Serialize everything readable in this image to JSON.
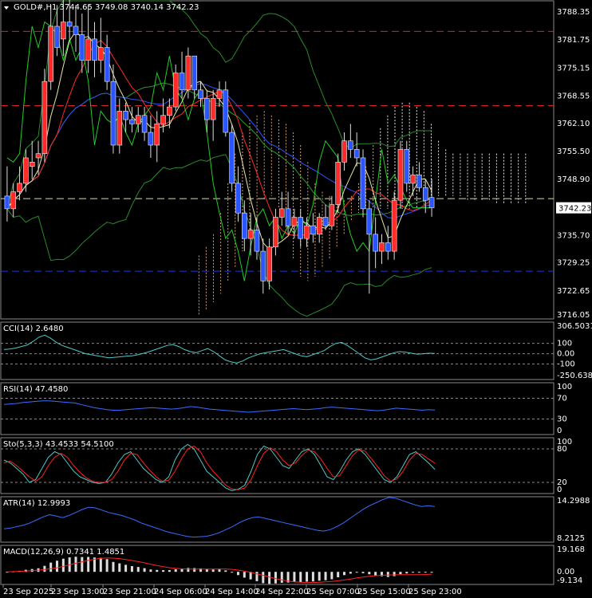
{
  "main": {
    "title": "GOLD#,H1  3744.65 3749.08 3740.14 3742.23",
    "price_ticks": [
      "3788.35",
      "3781.75",
      "3775.15",
      "3768.55",
      "3762.10",
      "3755.50",
      "3748.90",
      "3742.30",
      "3735.70",
      "3729.25",
      "3722.65",
      "3716.05"
    ],
    "price_range": [
      3716.05,
      3791.0
    ],
    "current_price": "3742.23",
    "current_price_value": 3742.23,
    "hlines": [
      {
        "value": 3783.8,
        "color": "#dd2222"
      },
      {
        "value": 3766.3,
        "color": "#dd2222"
      },
      {
        "value": 3744.4,
        "color": "#dddd99"
      },
      {
        "value": 3727.3,
        "color": "#2233dd"
      }
    ],
    "time_labels": [
      "23 Sep 2025",
      "23 Sep 13:00",
      "23 Sep 21:00",
      "24 Sep 06:00",
      "24 Sep 14:00",
      "24 Sep 22:00",
      "25 Sep 07:00",
      "25 Sep 15:00",
      "25 Sep 23:00"
    ]
  },
  "cci": {
    "title": "CCI(14) 2.6480",
    "ticks": [
      "306.5031",
      "100",
      "0.00",
      "-100",
      "-250.6388"
    ],
    "range": [
      -250.6388,
      306.5031
    ],
    "levels": [
      100,
      0,
      -100
    ]
  },
  "rsi": {
    "title": "RSI(14) 47.4580",
    "ticks": [
      "100",
      "70",
      "30",
      "0"
    ],
    "range": [
      0,
      100
    ],
    "levels": [
      70,
      30
    ]
  },
  "sto": {
    "title": "Sto(5,3,3) 43.4533 54.5100",
    "ticks": [
      "100",
      "80",
      "20",
      "0"
    ],
    "range": [
      0,
      100
    ],
    "levels": [
      80,
      20
    ]
  },
  "atr": {
    "title": "ATR(14) 12.9993",
    "ticks": [
      "14.2988",
      "8.2125"
    ],
    "range": [
      8.2125,
      14.2988
    ]
  },
  "macd": {
    "title": "MACD(12,26,9) 0.7341 1.4851",
    "ticks": [
      "19.168",
      "0.00",
      "-9.134"
    ],
    "range": [
      -9.134,
      19.168
    ]
  },
  "colors": {
    "bull": "#ff2a2a",
    "bear": "#2a55ff",
    "signal": "#ff2222",
    "cci": "#4fc8c8",
    "rsi": "#3b6cff",
    "sto_main": "#4fc8c8",
    "sto_signal": "#ff2222",
    "atr": "#3b6cff",
    "macd_hist": "#dddddd"
  },
  "chart_data": {
    "type": "candlestick",
    "symbol": "GOLD#",
    "timeframe": "H1",
    "ohlc_last": {
      "open": 3744.65,
      "high": 3749.08,
      "low": 3740.14,
      "close": 3742.23
    },
    "candles": [
      [
        3745,
        3752,
        3739,
        3742
      ],
      [
        3742,
        3748,
        3740,
        3746
      ],
      [
        3746,
        3752,
        3744,
        3748
      ],
      [
        3748,
        3756,
        3746,
        3754
      ],
      [
        3752,
        3758,
        3749,
        3753
      ],
      [
        3754,
        3758,
        3750,
        3755
      ],
      [
        3755,
        3775,
        3753,
        3772
      ],
      [
        3772,
        3790,
        3770,
        3785
      ],
      [
        3785,
        3790,
        3778,
        3780
      ],
      [
        3782,
        3794,
        3778,
        3786
      ],
      [
        3786,
        3792,
        3782,
        3785
      ],
      [
        3785,
        3790,
        3779,
        3783
      ],
      [
        3783,
        3788,
        3774,
        3777
      ],
      [
        3777,
        3790,
        3774,
        3782
      ],
      [
        3782,
        3786,
        3773,
        3777
      ],
      [
        3777,
        3787,
        3774,
        3780
      ],
      [
        3780,
        3783,
        3770,
        3772
      ],
      [
        3772,
        3776,
        3755,
        3757
      ],
      [
        3757,
        3768,
        3755,
        3765
      ],
      [
        3765,
        3767,
        3760,
        3763
      ],
      [
        3763,
        3766,
        3760,
        3762
      ],
      [
        3762,
        3766,
        3760,
        3764
      ],
      [
        3764,
        3766,
        3758,
        3760
      ],
      [
        3760,
        3764,
        3754,
        3757
      ],
      [
        3757,
        3765,
        3753,
        3762
      ],
      [
        3762,
        3768,
        3760,
        3764
      ],
      [
        3764,
        3768,
        3761,
        3766
      ],
      [
        3766,
        3776,
        3765,
        3774
      ],
      [
        3774,
        3779,
        3768,
        3770
      ],
      [
        3770,
        3780,
        3768,
        3778
      ],
      [
        3778,
        3778,
        3768,
        3770
      ],
      [
        3770,
        3772,
        3766,
        3768
      ],
      [
        3768,
        3770,
        3760,
        3763
      ],
      [
        3763,
        3770,
        3758,
        3768
      ],
      [
        3768,
        3772,
        3766,
        3770
      ],
      [
        3770,
        3772,
        3759,
        3760
      ],
      [
        3760,
        3762,
        3746,
        3748
      ],
      [
        3748,
        3752,
        3739,
        3741
      ],
      [
        3741,
        3744,
        3732,
        3735
      ],
      [
        3735,
        3741,
        3731,
        3737
      ],
      [
        3737,
        3740,
        3730,
        3732
      ],
      [
        3732,
        3735,
        3722,
        3725
      ],
      [
        3725,
        3735,
        3723,
        3733
      ],
      [
        3733,
        3742,
        3731,
        3740
      ],
      [
        3740,
        3746,
        3738,
        3742
      ],
      [
        3742,
        3746,
        3736,
        3738
      ],
      [
        3738,
        3742,
        3735,
        3740
      ],
      [
        3740,
        3742,
        3733,
        3735
      ],
      [
        3735,
        3740,
        3733,
        3738
      ],
      [
        3738,
        3741,
        3734,
        3736
      ],
      [
        3736,
        3741,
        3734,
        3740
      ],
      [
        3740,
        3743,
        3737,
        3738
      ],
      [
        3738,
        3745,
        3737,
        3743
      ],
      [
        3743,
        3755,
        3741,
        3753
      ],
      [
        3753,
        3760,
        3751,
        3758
      ],
      [
        3758,
        3762,
        3754,
        3756
      ],
      [
        3756,
        3760,
        3752,
        3754
      ],
      [
        3754,
        3756,
        3740,
        3742
      ],
      [
        3742,
        3744,
        3722,
        3736
      ],
      [
        3736,
        3740,
        3728,
        3732
      ],
      [
        3732,
        3736,
        3729,
        3734
      ],
      [
        3734,
        3738,
        3730,
        3732
      ],
      [
        3732,
        3746,
        3730,
        3744
      ],
      [
        3744,
        3758,
        3742,
        3756
      ],
      [
        3756,
        3758,
        3746,
        3748
      ],
      [
        3748,
        3752,
        3745,
        3750
      ],
      [
        3750,
        3753,
        3746,
        3747
      ],
      [
        3747,
        3749,
        3741,
        3744
      ],
      [
        3744.65,
        3749.08,
        3740.14,
        3742.23
      ]
    ],
    "indicators": {
      "cci": [
        40,
        45,
        55,
        70,
        85,
        120,
        160,
        180,
        150,
        110,
        80,
        60,
        40,
        20,
        0,
        -10,
        -20,
        -30,
        -40,
        -35,
        -30,
        -25,
        -20,
        -10,
        5,
        20,
        40,
        60,
        80,
        90,
        70,
        40,
        20,
        10,
        30,
        50,
        20,
        -20,
        -60,
        -80,
        -90,
        -70,
        -40,
        -20,
        0,
        10,
        20,
        30,
        40,
        20,
        0,
        -20,
        -30,
        -10,
        10,
        30,
        70,
        100,
        110,
        80,
        40,
        0,
        -40,
        -60,
        -50,
        -30,
        -10,
        10,
        20,
        15,
        5,
        -5,
        0,
        5,
        3
      ],
      "rsi": [
        58,
        59,
        60,
        62,
        63,
        64,
        65,
        65,
        64,
        63,
        62,
        61,
        58,
        55,
        52,
        50,
        48,
        47,
        47,
        48,
        49,
        50,
        51,
        52,
        51,
        50,
        49,
        50,
        52,
        54,
        53,
        51,
        49,
        48,
        47,
        46,
        45,
        44,
        43,
        44,
        45,
        46,
        47,
        48,
        49,
        50,
        49,
        48,
        49,
        50,
        52,
        53,
        52,
        51,
        50,
        49,
        48,
        47,
        46,
        47,
        49,
        51,
        50,
        49,
        48,
        47,
        48,
        47.458
      ],
      "sto_main": [
        60,
        55,
        45,
        35,
        20,
        25,
        45,
        65,
        75,
        70,
        55,
        40,
        30,
        25,
        20,
        18,
        20,
        35,
        55,
        70,
        75,
        60,
        45,
        35,
        25,
        20,
        30,
        60,
        80,
        88,
        80,
        60,
        40,
        30,
        20,
        10,
        5,
        8,
        15,
        40,
        70,
        85,
        80,
        65,
        50,
        45,
        60,
        75,
        80,
        70,
        50,
        30,
        25,
        40,
        60,
        75,
        80,
        70,
        55,
        40,
        25,
        20,
        30,
        50,
        70,
        75,
        65,
        55,
        43.4533
      ],
      "sto_signal": [
        55,
        58,
        50,
        40,
        30,
        22,
        30,
        50,
        65,
        72,
        65,
        50,
        38,
        28,
        22,
        20,
        20,
        25,
        40,
        60,
        72,
        70,
        55,
        42,
        30,
        22,
        24,
        40,
        62,
        80,
        85,
        75,
        55,
        40,
        28,
        15,
        8,
        7,
        10,
        25,
        50,
        72,
        82,
        75,
        60,
        50,
        55,
        68,
        78,
        75,
        62,
        45,
        30,
        32,
        50,
        68,
        78,
        76,
        62,
        48,
        32,
        22,
        26,
        40,
        60,
        72,
        70,
        62,
        54.51
      ],
      "atr": [
        10.0,
        10.1,
        10.3,
        10.5,
        10.8,
        11.2,
        11.6,
        11.9,
        11.7,
        11.5,
        11.8,
        12.2,
        12.6,
        12.9,
        12.8,
        12.5,
        12.2,
        12.0,
        11.8,
        11.5,
        11.2,
        10.8,
        10.5,
        10.2,
        9.9,
        9.6,
        9.4,
        9.2,
        9.0,
        8.9,
        8.95,
        9.0,
        9.2,
        9.5,
        9.9,
        10.3,
        10.8,
        11.2,
        11.5,
        11.6,
        11.4,
        11.2,
        11.0,
        10.8,
        10.6,
        10.4,
        10.2,
        10.0,
        9.8,
        9.7,
        9.9,
        10.3,
        10.8,
        11.4,
        12.0,
        12.6,
        13.1,
        13.5,
        13.9,
        14.2,
        14.1,
        13.8,
        13.5,
        13.2,
        13.0,
        13.1,
        12.9993
      ]
    }
  }
}
